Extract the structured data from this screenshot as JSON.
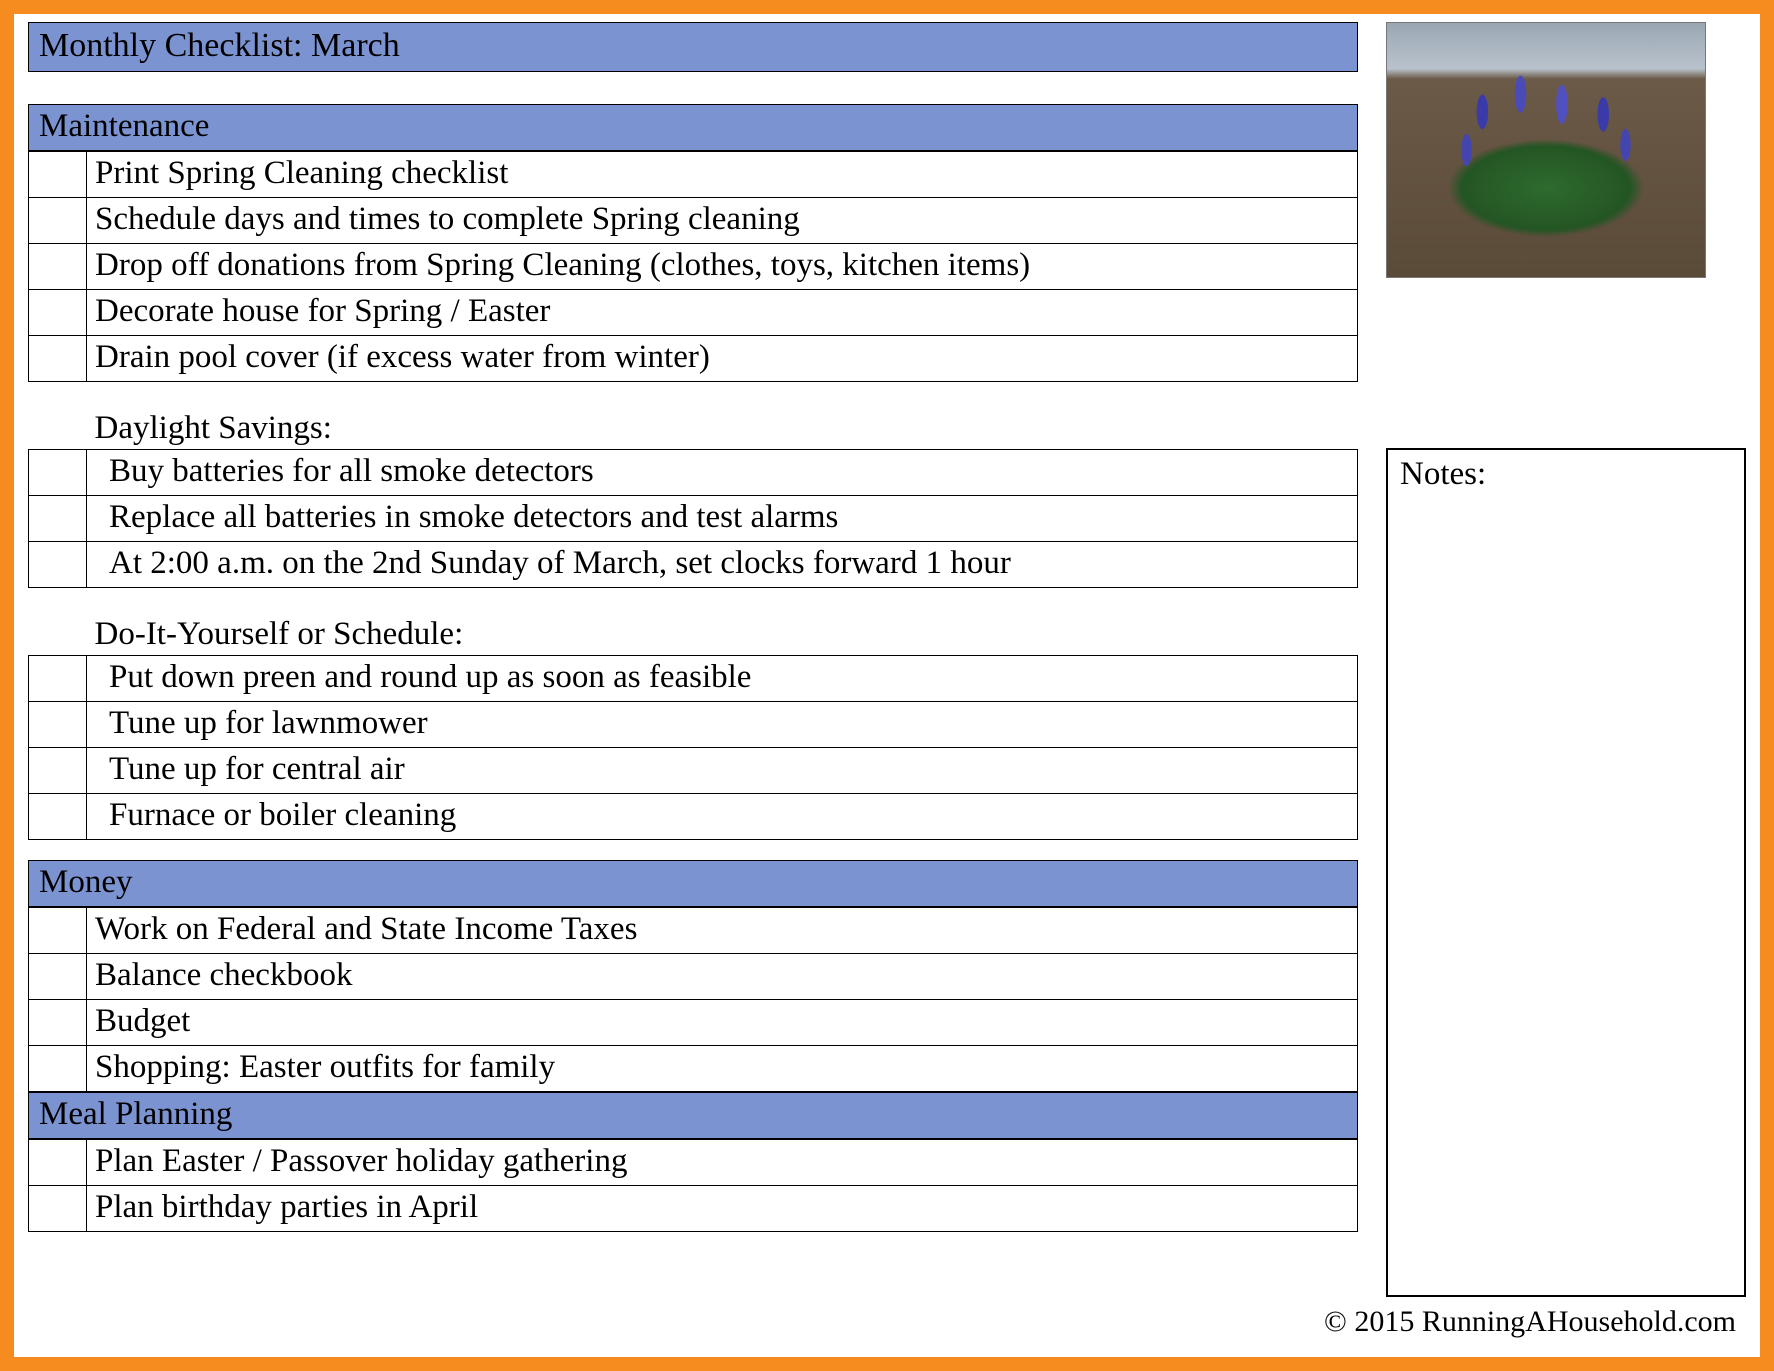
{
  "title": "Monthly Checklist: March",
  "sections": {
    "maintenance": {
      "header": "Maintenance",
      "items": [
        "Print Spring Cleaning checklist",
        "Schedule days and times to complete Spring cleaning",
        "Drop off donations from Spring Cleaning (clothes, toys, kitchen items)",
        "Decorate house for Spring / Easter",
        "Drain pool cover (if excess water from winter)"
      ],
      "sub1_label": "Daylight Savings:",
      "sub1_items": [
        "Buy batteries for all smoke detectors",
        "Replace all batteries in smoke detectors and test alarms",
        "At 2:00 a.m. on the 2nd Sunday of March, set clocks forward 1 hour"
      ],
      "sub2_label": "Do-It-Yourself or Schedule:",
      "sub2_items": [
        "Put down preen and round up as soon as feasible",
        "Tune up for lawnmower",
        "Tune up for central air",
        "Furnace or boiler cleaning"
      ]
    },
    "money": {
      "header": "Money",
      "items": [
        "Work on Federal and State Income Taxes",
        "Balance checkbook",
        "Budget",
        "Shopping: Easter outfits for family"
      ]
    },
    "meal": {
      "header": "Meal Planning",
      "items": [
        "Plan Easter / Passover holiday gathering",
        "Plan birthday parties in April"
      ]
    }
  },
  "notes_label": "Notes:",
  "copyright": "© 2015 RunningAHousehold.com"
}
